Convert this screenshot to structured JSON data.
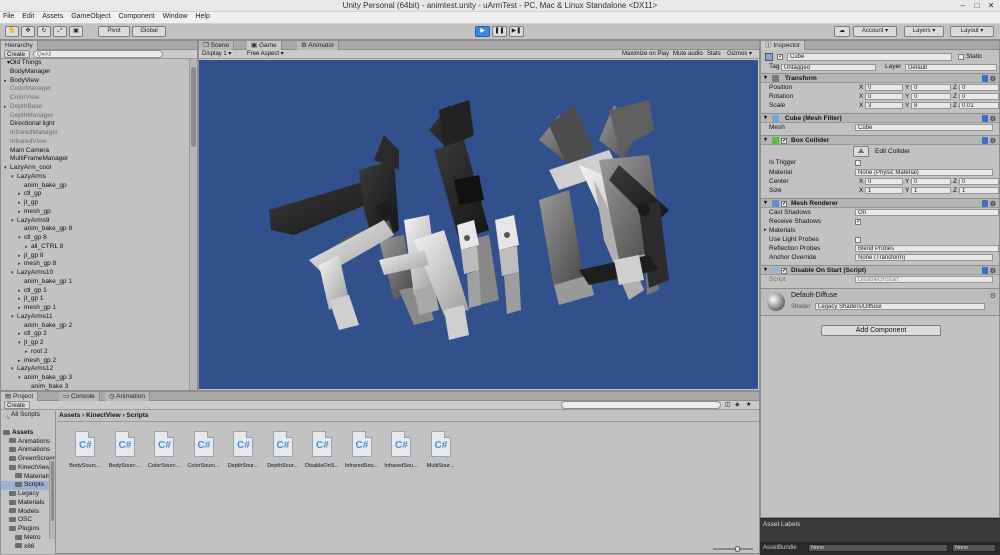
{
  "window": {
    "title": "Unity Personal (64bit) - animtest.unity - uArmTest - PC, Mac & Linux Standalone <DX11>"
  },
  "menu": [
    "File",
    "Edit",
    "Assets",
    "GameObject",
    "Component",
    "Window",
    "Help"
  ],
  "toolbar": {
    "pivot": "Pivot",
    "global": "Global",
    "account": "Account",
    "layers": "Layers",
    "layout": "Layout"
  },
  "hierarchy": {
    "tab": "Hierarchy",
    "create": "Create",
    "search_placeholder": "Q▾All",
    "items": [
      {
        "label": "Old Things",
        "indent": 0,
        "arrow": "",
        "dim": false
      },
      {
        "label": "BodyManager",
        "indent": 0,
        "arrow": "",
        "dim": false
      },
      {
        "label": "BodyView",
        "indent": 0,
        "arrow": "▸",
        "dim": false
      },
      {
        "label": "ColorManager",
        "indent": 0,
        "arrow": "",
        "dim": true
      },
      {
        "label": "ColorView",
        "indent": 0,
        "arrow": "",
        "dim": true
      },
      {
        "label": "DepthBase",
        "indent": 0,
        "arrow": "▸",
        "dim": true
      },
      {
        "label": "DepthManager",
        "indent": 0,
        "arrow": "",
        "dim": true
      },
      {
        "label": "Directional light",
        "indent": 0,
        "arrow": "",
        "dim": false
      },
      {
        "label": "InfraredManager",
        "indent": 0,
        "arrow": "",
        "dim": true
      },
      {
        "label": "InfraredView",
        "indent": 0,
        "arrow": "",
        "dim": true
      },
      {
        "label": "Main Camera",
        "indent": 0,
        "arrow": "",
        "dim": false
      },
      {
        "label": "MultiFrameManager",
        "indent": 0,
        "arrow": "",
        "dim": false
      },
      {
        "label": "LazyArm_cool",
        "indent": 0,
        "arrow": "▾",
        "dim": false
      },
      {
        "label": "LazyArms",
        "indent": 1,
        "arrow": "▾",
        "dim": false
      },
      {
        "label": "anim_bake_gp",
        "indent": 2,
        "arrow": "",
        "dim": false
      },
      {
        "label": "ctl_gp",
        "indent": 2,
        "arrow": "▸",
        "dim": false
      },
      {
        "label": "jt_gp",
        "indent": 2,
        "arrow": "▸",
        "dim": false
      },
      {
        "label": "mesh_gp",
        "indent": 2,
        "arrow": "▸",
        "dim": false
      },
      {
        "label": "LazyArms9",
        "indent": 1,
        "arrow": "▾",
        "dim": false
      },
      {
        "label": "anim_bake_gp 8",
        "indent": 2,
        "arrow": "",
        "dim": false
      },
      {
        "label": "ctl_gp 8",
        "indent": 2,
        "arrow": "▾",
        "dim": false
      },
      {
        "label": "all_CTRL 8",
        "indent": 3,
        "arrow": "▸",
        "dim": false
      },
      {
        "label": "jt_gp 8",
        "indent": 2,
        "arrow": "▸",
        "dim": false
      },
      {
        "label": "mesh_gp 8",
        "indent": 2,
        "arrow": "▸",
        "dim": false
      },
      {
        "label": "LazyArms10",
        "indent": 1,
        "arrow": "▾",
        "dim": false
      },
      {
        "label": "anim_bake_gp 1",
        "indent": 2,
        "arrow": "",
        "dim": false
      },
      {
        "label": "ctl_gp 1",
        "indent": 2,
        "arrow": "▸",
        "dim": false
      },
      {
        "label": "jt_gp 1",
        "indent": 2,
        "arrow": "▸",
        "dim": false
      },
      {
        "label": "mesh_gp 1",
        "indent": 2,
        "arrow": "▸",
        "dim": false
      },
      {
        "label": "LazyArms11",
        "indent": 1,
        "arrow": "▾",
        "dim": false
      },
      {
        "label": "anim_bake_gp 2",
        "indent": 2,
        "arrow": "",
        "dim": false
      },
      {
        "label": "ctl_gp 2",
        "indent": 2,
        "arrow": "▸",
        "dim": false
      },
      {
        "label": "jt_gp 2",
        "indent": 2,
        "arrow": "▾",
        "dim": false
      },
      {
        "label": "root 2",
        "indent": 3,
        "arrow": "▸",
        "dim": false
      },
      {
        "label": "mesh_gp 2",
        "indent": 2,
        "arrow": "▸",
        "dim": false
      },
      {
        "label": "LazyArms12",
        "indent": 1,
        "arrow": "▾",
        "dim": false
      },
      {
        "label": "anim_bake_gp 3",
        "indent": 2,
        "arrow": "▾",
        "dim": false
      },
      {
        "label": "anim_bake 3",
        "indent": 3,
        "arrow": "",
        "dim": false
      }
    ]
  },
  "scene_tabs": [
    "Scene",
    "Game",
    "Animator"
  ],
  "game_toolbar": {
    "display": "Display 1",
    "aspect": "Free Aspect",
    "maximize": "Maximize on Play",
    "mute": "Mute audio",
    "stats": "Stats",
    "gizmos": "Gizmos"
  },
  "inspector": {
    "tab": "Inspector",
    "object_name": "Cube",
    "static": "Static",
    "tag_label": "Tag",
    "tag_value": "Untagged",
    "layer_label": "Layer",
    "layer_value": "Default",
    "transform": {
      "title": "Transform",
      "rows": [
        {
          "label": "Position",
          "x": "0",
          "y": "0",
          "z": "0"
        },
        {
          "label": "Rotation",
          "x": "0",
          "y": "0",
          "z": "0"
        },
        {
          "label": "Scale",
          "x": "3",
          "y": "8",
          "z": "0.01"
        }
      ]
    },
    "mesh_filter": {
      "title": "Cube (Mesh Filter)",
      "mesh_label": "Mesh",
      "mesh_value": "Cube"
    },
    "box_collider": {
      "title": "Box Collider",
      "edit": "Edit Collider",
      "is_trigger": "Is Trigger",
      "material_label": "Material",
      "material_value": "None (Physic Material)",
      "center": {
        "label": "Center",
        "x": "0",
        "y": "0",
        "z": "0"
      },
      "size": {
        "label": "Size",
        "x": "1",
        "y": "1",
        "z": "1"
      }
    },
    "mesh_renderer": {
      "title": "Mesh Renderer",
      "cast_shadows": "Cast Shadows",
      "cast_value": "On",
      "receive_shadows": "Receive Shadows",
      "materials": "Materials",
      "light_probes": "Use Light Probes",
      "reflection_probes": "Reflection Probes",
      "reflection_value": "Blend Probes",
      "anchor_override": "Anchor Override",
      "anchor_value": "None (Transform)"
    },
    "script": {
      "title": "Disable On Start (Script)",
      "label": "Script",
      "value": "DisableOnStart"
    },
    "material": {
      "name": "Default-Diffuse",
      "shader_label": "Shader",
      "shader_value": "Legacy Shaders/Diffuse"
    },
    "add_component": "Add Component",
    "asset_labels": "Asset Labels",
    "asset_bundle": "AssetBundle",
    "asset_bundle_value": "None",
    "asset_bundle_value2": "None"
  },
  "xyz": [
    "X",
    "Y",
    "Z"
  ],
  "project": {
    "tabs": [
      "Project",
      "Console",
      "Animation"
    ],
    "create": "Create",
    "breadcrumb": "Assets › KinectView › Scripts",
    "favorites": "All Scripts",
    "tree": [
      {
        "label": "Assets",
        "indent": 0,
        "bold": true
      },
      {
        "label": "Animations",
        "indent": 1
      },
      {
        "label": "Animations",
        "indent": 1
      },
      {
        "label": "GreenScreen",
        "indent": 1
      },
      {
        "label": "KinectView",
        "indent": 1
      },
      {
        "label": "Materials",
        "indent": 2
      },
      {
        "label": "Scripts",
        "indent": 2,
        "selected": true
      },
      {
        "label": "Legacy",
        "indent": 1
      },
      {
        "label": "Materials",
        "indent": 1
      },
      {
        "label": "Models",
        "indent": 1
      },
      {
        "label": "OSC",
        "indent": 1
      },
      {
        "label": "Plugins",
        "indent": 1
      },
      {
        "label": "Metro",
        "indent": 2
      },
      {
        "label": "x86",
        "indent": 2
      }
    ],
    "files": [
      "BodySourc...",
      "BodySourc...",
      "ColorSourc...",
      "ColorSourc...",
      "DepthSour...",
      "DepthSour...",
      "DisableOnS...",
      "InfraredSou...",
      "InfraredSou...",
      "MultiSour..."
    ]
  },
  "colors": {
    "play_blue": "#3b86e0",
    "game_bg": "#32508c",
    "panel": "#c2c2c2"
  }
}
